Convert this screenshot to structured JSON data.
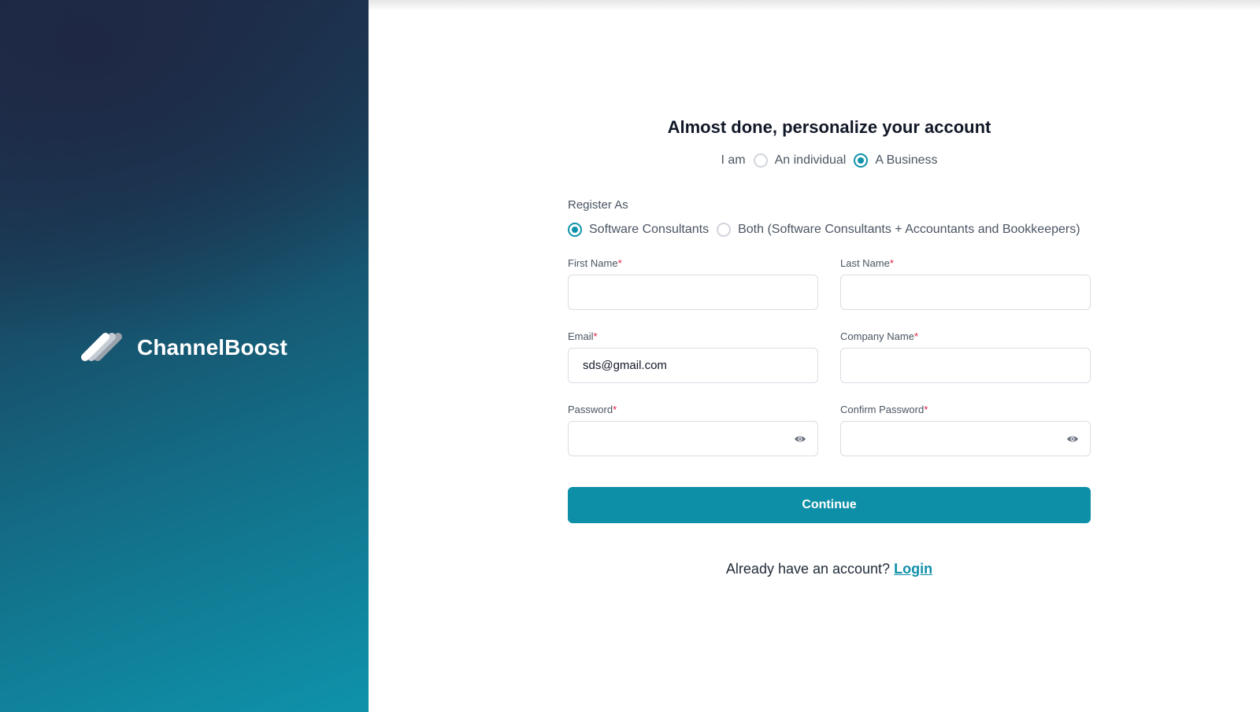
{
  "brand": {
    "name": "ChannelBoost"
  },
  "form": {
    "title": "Almost done, personalize your account",
    "iam_label": "I am",
    "account_type_options": [
      "An individual",
      "A Business"
    ],
    "account_type_selected": "A Business",
    "register_as_label": "Register As",
    "register_as_options": [
      "Software Consultants",
      "Both (Software Consultants + Accountants and Bookkeepers)"
    ],
    "register_as_selected": "Software Consultants",
    "fields": {
      "first_name_label": "First Name",
      "first_name_value": "",
      "last_name_label": "Last Name",
      "last_name_value": "",
      "email_label": "Email",
      "email_value": "sds@gmail.com",
      "company_name_label": "Company Name",
      "company_name_value": "",
      "password_label": "Password",
      "password_value": "",
      "confirm_password_label": "Confirm Password",
      "confirm_password_value": ""
    },
    "required_marker": "*",
    "continue_label": "Continue",
    "login_prompt": "Already have an account?",
    "login_link": "Login"
  },
  "colors": {
    "accent": "#0e8fa8",
    "required": "#e11d48",
    "panel_dark": "#1e2a47",
    "panel_light": "#0e93ab"
  },
  "icons": [
    "channelboost-logo-icon",
    "eye-icon",
    "eye-icon"
  ]
}
